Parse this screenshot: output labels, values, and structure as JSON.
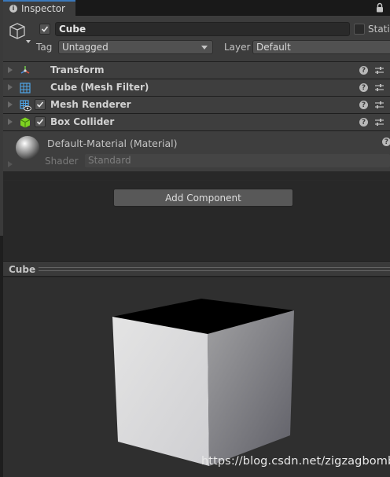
{
  "tab": {
    "title": "Inspector"
  },
  "object": {
    "active": true,
    "name": "Cube",
    "static_label": "Static",
    "tag_label": "Tag",
    "tag_value": "Untagged",
    "layer_label": "Layer",
    "layer_value": "Default"
  },
  "components": [
    {
      "label": "Transform",
      "icon": "transform-icon",
      "has_checkbox": false
    },
    {
      "label": "Cube (Mesh Filter)",
      "icon": "mesh-filter-icon",
      "has_checkbox": false
    },
    {
      "label": "Mesh Renderer",
      "icon": "mesh-renderer-icon",
      "has_checkbox": true,
      "enabled": true
    },
    {
      "label": "Box Collider",
      "icon": "box-collider-icon",
      "has_checkbox": true,
      "enabled": true
    }
  ],
  "material": {
    "name": "Default-Material (Material)",
    "shader_label": "Shader",
    "shader_value": "Standard"
  },
  "add_component_label": "Add Component",
  "preview": {
    "title": "Cube"
  },
  "watermark": "https://blog.csdn.net/zigzagbomb",
  "colors": {
    "tab_accent": "#3a79bb",
    "panel": "#3e3e3e",
    "background": "#282828"
  }
}
